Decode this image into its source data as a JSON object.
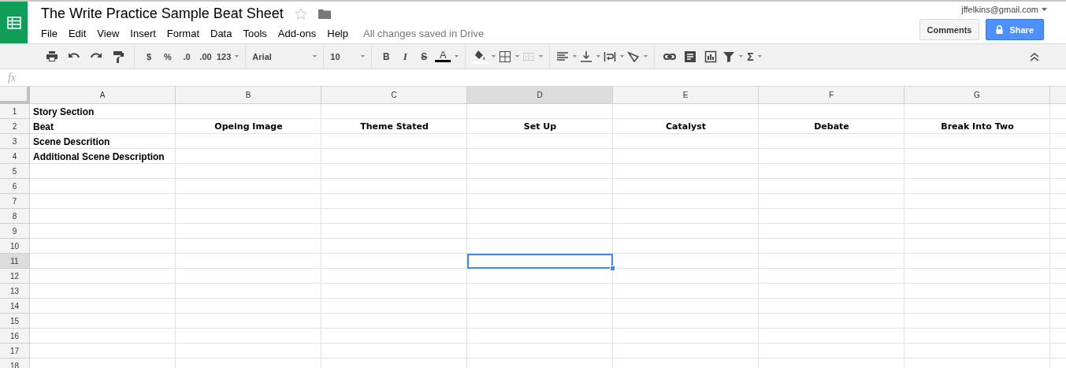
{
  "document": {
    "title": "The Write Practice Sample Beat Sheet",
    "save_status": "All changes saved in Drive"
  },
  "menu": [
    "File",
    "Edit",
    "View",
    "Insert",
    "Format",
    "Data",
    "Tools",
    "Add-ons",
    "Help"
  ],
  "account": {
    "email": "jffelkins@gmail.com"
  },
  "buttons": {
    "comments": "Comments",
    "share": "Share"
  },
  "toolbar": {
    "currency": "$",
    "percent": "%",
    "decrease_decimals": ".0",
    "increase_decimals": ".00",
    "more_formats": "123",
    "font": "Arial",
    "font_size": "10",
    "bold": "B",
    "italic": "I",
    "strikethrough": "S",
    "text_color": "A",
    "functions": "Σ"
  },
  "formula_bar": {
    "label": "fx"
  },
  "columns": [
    {
      "label": "A",
      "selected": false
    },
    {
      "label": "B",
      "selected": false
    },
    {
      "label": "C",
      "selected": false
    },
    {
      "label": "D",
      "selected": true
    },
    {
      "label": "E",
      "selected": false
    },
    {
      "label": "F",
      "selected": false
    },
    {
      "label": "G",
      "selected": false
    }
  ],
  "rows": [
    {
      "number": "1",
      "selected": false,
      "cells": [
        "Story Section"
      ]
    },
    {
      "number": "2",
      "selected": false,
      "cells": [
        "Beat",
        "Opeing Image",
        "Theme Stated",
        "Set Up",
        "Catalyst",
        "Debate",
        "Break Into Two"
      ]
    },
    {
      "number": "3",
      "selected": false,
      "cells": [
        "Scene Descrition"
      ]
    },
    {
      "number": "4",
      "selected": false,
      "cells": [
        "Additional Scene Description"
      ]
    },
    {
      "number": "5",
      "selected": false
    },
    {
      "number": "6",
      "selected": false
    },
    {
      "number": "7",
      "selected": false
    },
    {
      "number": "8",
      "selected": false
    },
    {
      "number": "9",
      "selected": false
    },
    {
      "number": "10",
      "selected": false
    },
    {
      "number": "11",
      "selected": true
    },
    {
      "number": "12",
      "selected": false
    },
    {
      "number": "13",
      "selected": false
    },
    {
      "number": "14",
      "selected": false
    },
    {
      "number": "15",
      "selected": false
    },
    {
      "number": "16",
      "selected": false
    },
    {
      "number": "17",
      "selected": false
    },
    {
      "number": "18",
      "selected": false
    }
  ]
}
